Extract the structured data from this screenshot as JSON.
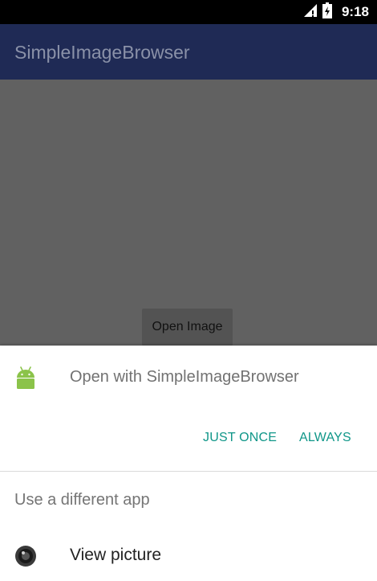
{
  "status_bar": {
    "time": "9:18",
    "icons": [
      "signal-icon",
      "battery-icon"
    ]
  },
  "app_bar": {
    "title": "SimpleImageBrowser"
  },
  "main": {
    "open_image_label": "Open Image"
  },
  "chooser": {
    "open_with_text": "Open with SimpleImageBrowser",
    "just_once_label": "JUST ONCE",
    "always_label": "ALWAYS",
    "different_app_label": "Use a different app",
    "apps": [
      {
        "label": "View picture",
        "icon": "camera-icon"
      }
    ]
  },
  "colors": {
    "app_bar": "#1f2a55",
    "accent": "#0f9688",
    "scrim": "#616161",
    "android_green": "#8bc34a"
  }
}
